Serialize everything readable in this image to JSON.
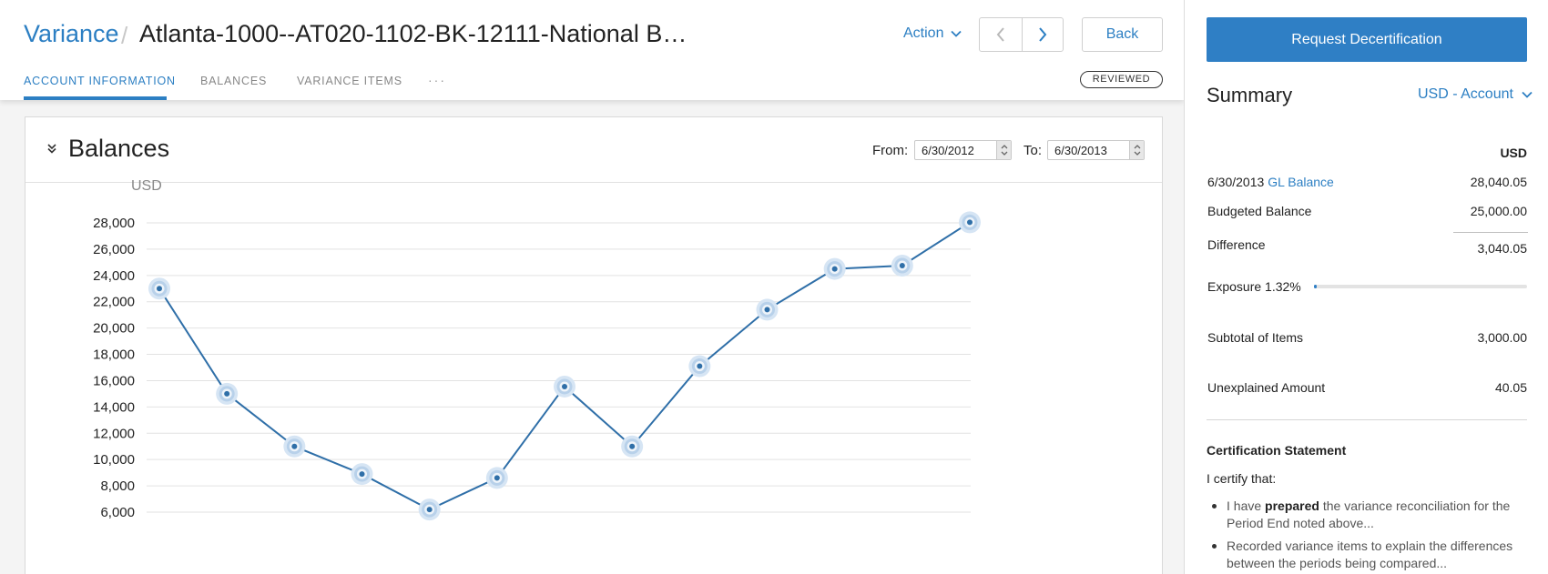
{
  "header": {
    "breadcrumb": "Variance",
    "title": "Atlanta-1000--AT020-1102-BK-12111-National B…",
    "action_label": "Action",
    "back_label": "Back",
    "status_badge": "REVIEWED"
  },
  "tabs": [
    {
      "label": "ACCOUNT INFORMATION",
      "active": true
    },
    {
      "label": "BALANCES",
      "active": false
    },
    {
      "label": "VARIANCE ITEMS",
      "active": false
    }
  ],
  "more_label": "···",
  "balances": {
    "title": "Balances",
    "from_label": "From:",
    "from_value": "6/30/2012",
    "to_label": "To:",
    "to_value": "6/30/2013"
  },
  "chart_data": {
    "type": "line",
    "title": "",
    "ylabel": "USD",
    "xlabel": "",
    "ylim": [
      6000,
      28000
    ],
    "y_ticks": [
      28000,
      26000,
      24000,
      22000,
      20000,
      18000,
      16000,
      14000,
      12000,
      10000,
      8000,
      6000
    ],
    "y_tick_labels": [
      "28,000",
      "26,000",
      "24,000",
      "22,000",
      "20,000",
      "18,000",
      "16,000",
      "14,000",
      "12,000",
      "10,000",
      "8,000",
      "6,000"
    ],
    "grid": true,
    "series": [
      {
        "values": [
          23000,
          15000,
          11000,
          8900,
          6200,
          8600,
          15550,
          11000,
          17100,
          21400,
          24500,
          24750,
          28040
        ],
        "color": "#2f6fa8"
      }
    ]
  },
  "summary": {
    "request_button": "Request Decertification",
    "title": "Summary",
    "currency_select": "USD - Account",
    "currency_header": "USD",
    "gl_date": "6/30/2013",
    "gl_link": "GL Balance",
    "gl_value": "28,040.05",
    "budgeted_label": "Budgeted Balance",
    "budgeted_value": "25,000.00",
    "difference_label": "Difference",
    "difference_value": "3,040.05",
    "exposure_label": "Exposure 1.32%",
    "exposure_fraction": 0.0132,
    "subtotal_label": "Subtotal of Items",
    "subtotal_value": "3,000.00",
    "unexplained_label": "Unexplained Amount",
    "unexplained_value": "40.05"
  },
  "certification": {
    "title": "Certification Statement",
    "intro": "I certify that:",
    "item1_pre": "I have ",
    "item1_bold": "prepared",
    "item1_post": " the variance reconciliation for the Period End noted above...",
    "item2": "Recorded variance items to explain the differences between the periods being compared..."
  }
}
